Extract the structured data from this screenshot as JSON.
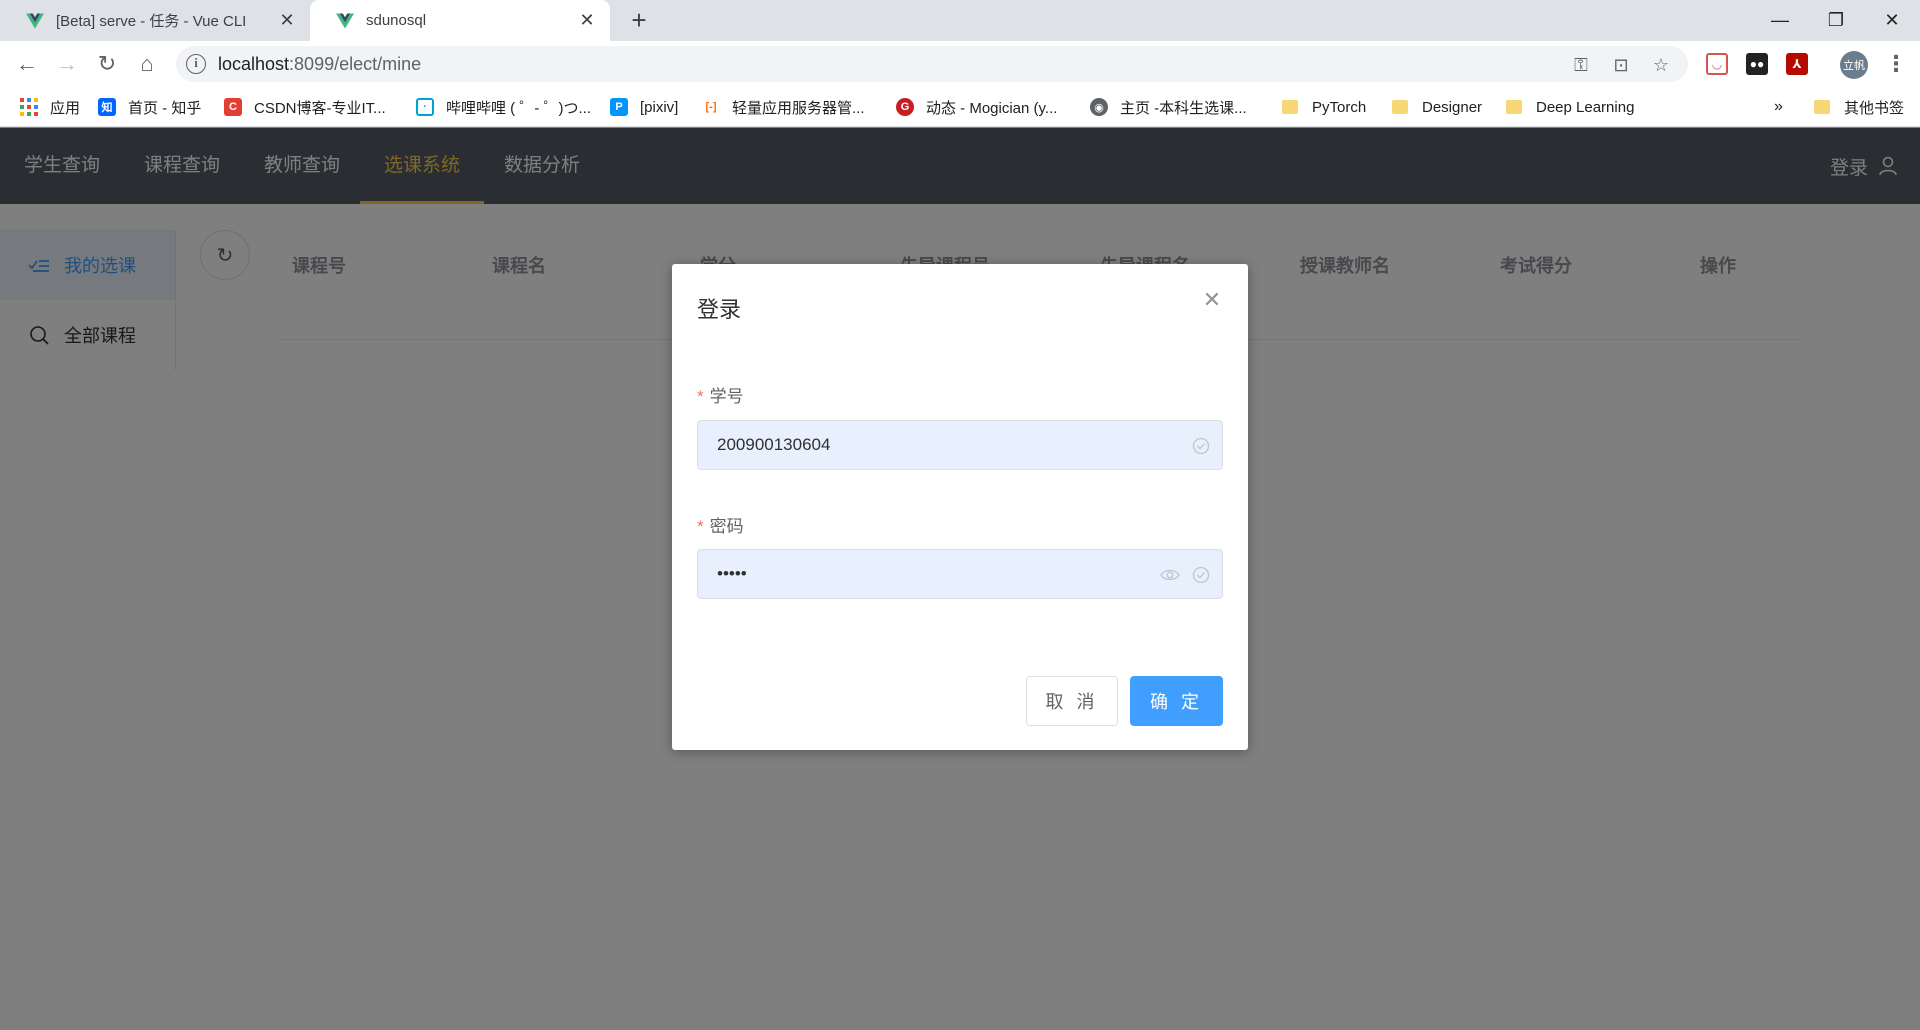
{
  "browser": {
    "tabs": [
      {
        "title": "[Beta] serve - 任务 - Vue CLI",
        "active": false
      },
      {
        "title": "sdunosql",
        "active": true
      }
    ],
    "url_host": "localhost",
    "url_rest": ":8099/elect/mine",
    "profile_initials": "立帆",
    "bookmarks": [
      {
        "label": "应用",
        "icon": "apps-grid-icon"
      },
      {
        "label": "首页 - 知乎",
        "icon": "zhihu-icon",
        "badge": "知",
        "color": "#0066ff"
      },
      {
        "label": "CSDN博客-专业IT...",
        "icon": "csdn-icon",
        "badge": "C",
        "color": "#e33e33"
      },
      {
        "label": "哔哩哔哩 ( ゜- ゜)つ...",
        "icon": "bilibili-icon",
        "badge": "▣",
        "color": "#00a1d6"
      },
      {
        "label": "[pixiv]",
        "icon": "pixiv-icon",
        "badge": "P",
        "color": "#0096fa"
      },
      {
        "label": "轻量应用服务器管...",
        "icon": "aliyun-icon",
        "badge": "[-]",
        "color": "#ff6a00"
      },
      {
        "label": "动态 - Mogician (y...",
        "icon": "gitee-icon",
        "badge": "G",
        "color": "#c71d23"
      },
      {
        "label": "主页 -本科生选课...",
        "icon": "globe-icon",
        "badge": "◉",
        "color": "#5f6368"
      },
      {
        "label": "PyTorch",
        "icon": "folder-icon"
      },
      {
        "label": "Designer",
        "icon": "folder-icon"
      },
      {
        "label": "Deep Learning",
        "icon": "folder-icon"
      }
    ],
    "bookmarks_more": "»",
    "other_bookmarks": "其他书签"
  },
  "app": {
    "nav": [
      "学生查询",
      "课程查询",
      "教师查询",
      "选课系统",
      "数据分析"
    ],
    "nav_active": 3,
    "login_label": "登录",
    "side_menu": [
      {
        "label": "我的选课",
        "icon": "list-check-icon",
        "active": true
      },
      {
        "label": "全部课程",
        "icon": "search-icon",
        "active": false
      }
    ],
    "table_headers": [
      "课程号",
      "课程名",
      "学分",
      "先导课程号",
      "先导课程名",
      "授课教师名",
      "考试得分",
      "操作"
    ]
  },
  "dialog": {
    "title": "登录",
    "fields": [
      {
        "label": "学号",
        "value": "200900130604",
        "required": true
      },
      {
        "label": "密码",
        "value": "•••••",
        "required": true
      }
    ],
    "cancel_label": "取 消",
    "confirm_label": "确 定"
  },
  "colors": {
    "nav_bg": "#545c64",
    "nav_active": "#ffd04b",
    "primary": "#409eff",
    "required": "#f56c6c"
  }
}
